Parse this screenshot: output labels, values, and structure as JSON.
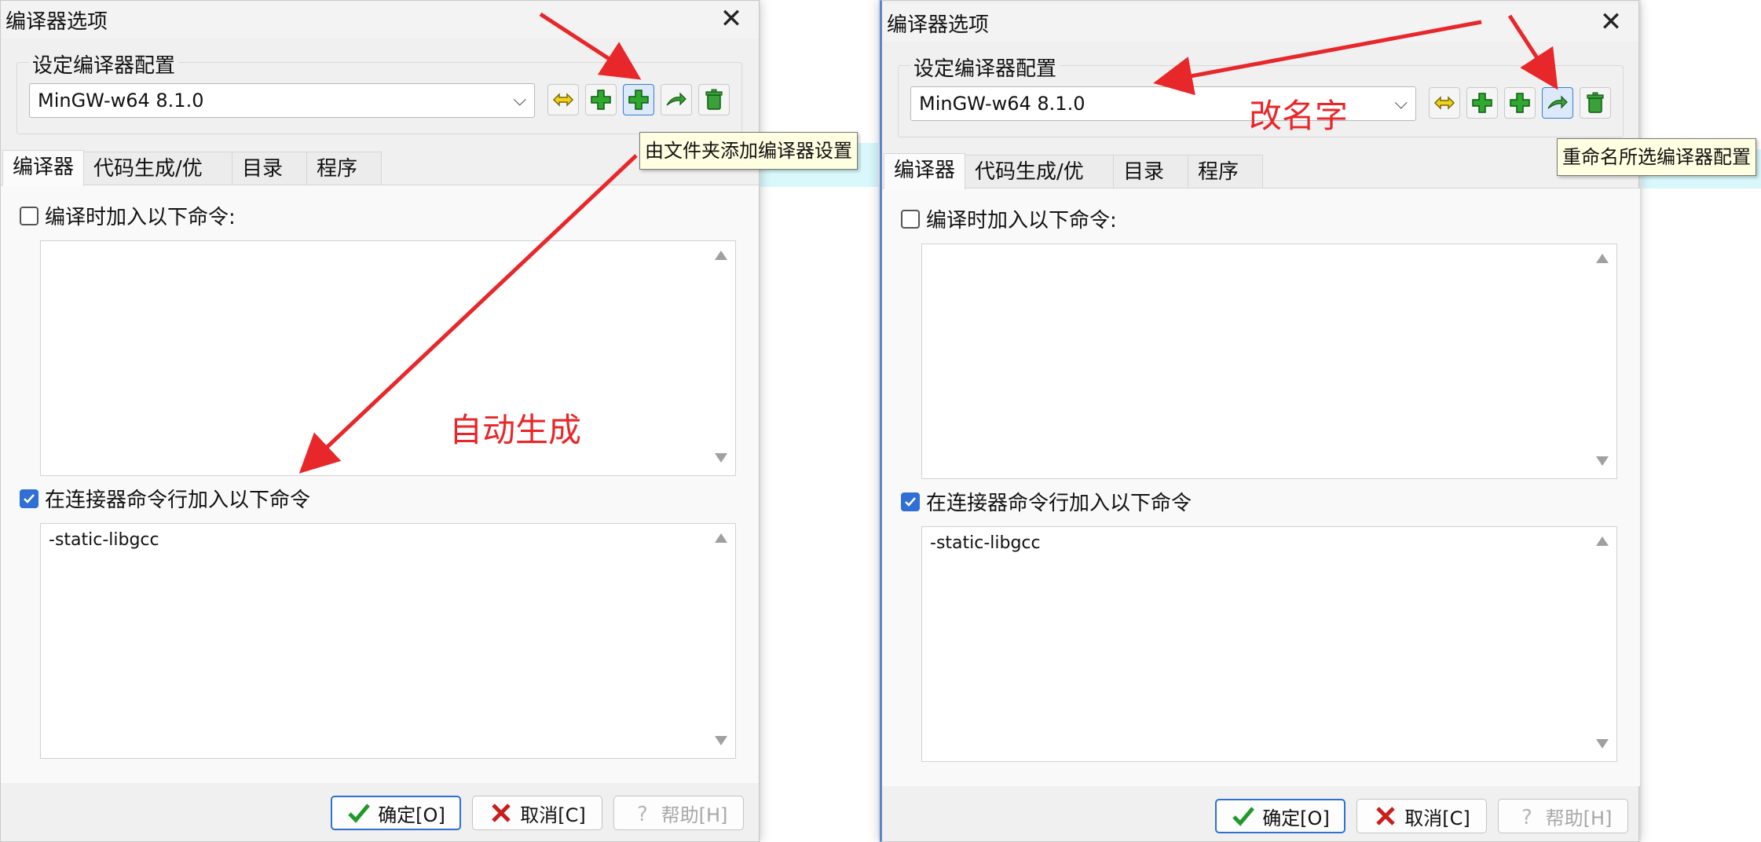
{
  "dialog_title": "编译器选项",
  "group_label": "设定编译器配置",
  "compiler_selected": "MinGW-w64 8.1.0",
  "tabs": [
    "编译器",
    "代码生成/优化",
    "目录",
    "程序"
  ],
  "checkbox_compile_label": "编译时加入以下命令:",
  "checkbox_linker_label": "在连接器命令行加入以下命令",
  "compile_commands": "",
  "linker_commands": "-static-libgcc",
  "buttons": {
    "ok": "确定[O]",
    "cancel": "取消[C]",
    "help": "帮助[H]"
  },
  "left": {
    "tooltip": "由文件夹添加编译器设置",
    "annotation": "自动生成"
  },
  "right": {
    "tooltip": "重命名所选编译器配置",
    "annotation": "改名字"
  },
  "colors": {
    "annotation_red": "#e8272a",
    "tooltip_bg": "#ffffe1",
    "accent_blue": "#2f6fd6",
    "green_plus": "#2fa82f"
  },
  "icons": {
    "toolbar": [
      "find-compiler-icon",
      "add-compiler-icon",
      "add-from-folder-icon",
      "rename-icon",
      "delete-icon"
    ],
    "ok": "check-icon",
    "cancel": "cross-icon",
    "help": "help-icon"
  }
}
